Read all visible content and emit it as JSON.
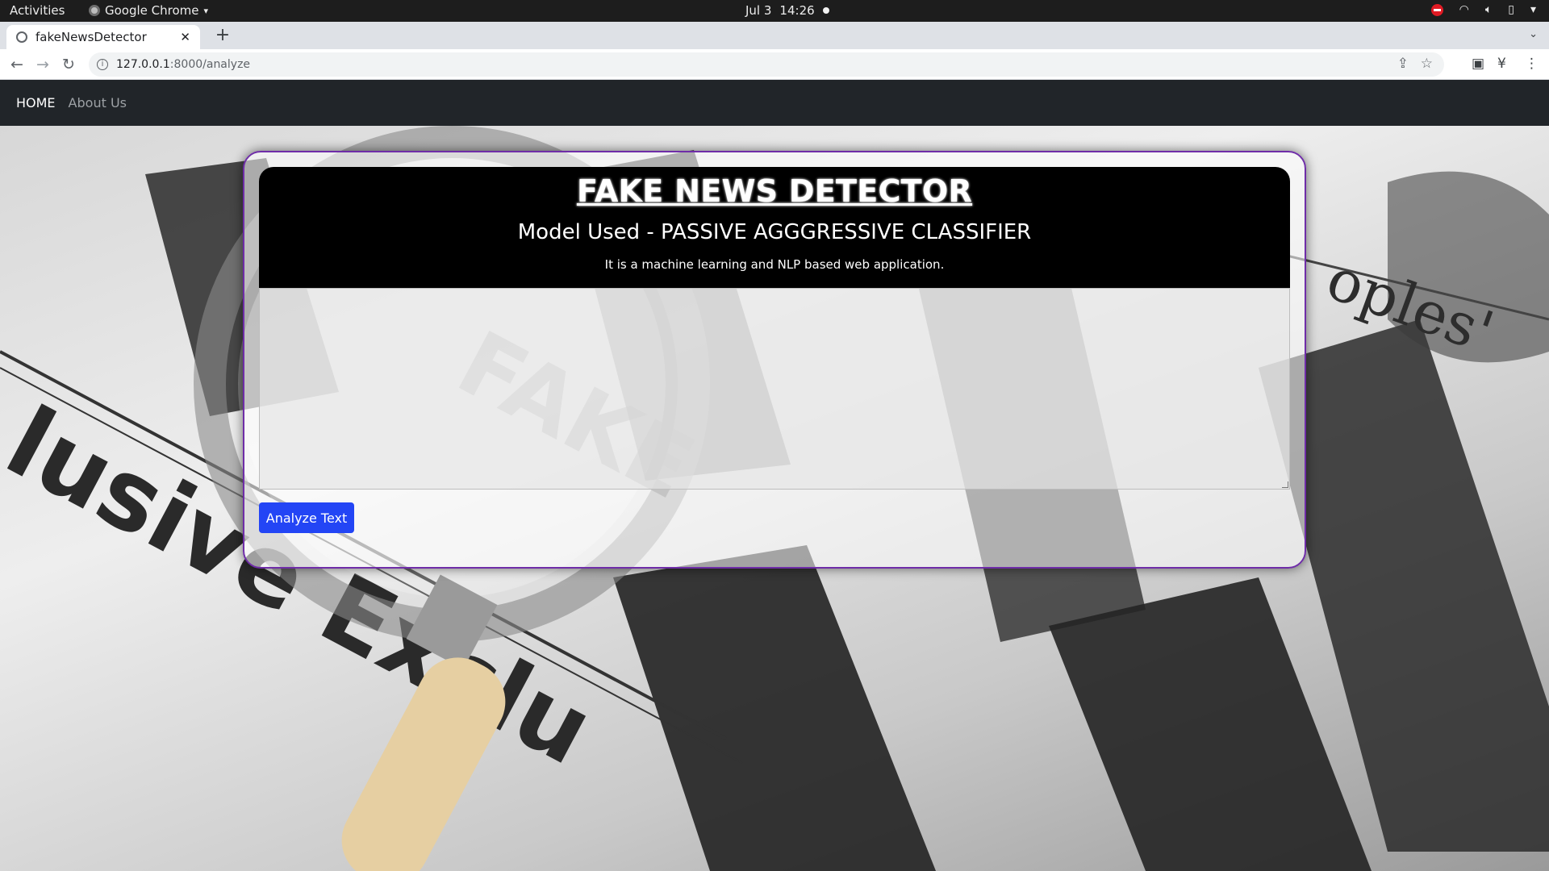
{
  "system_bar": {
    "activities": "Activities",
    "app_name": "Google Chrome",
    "date": "Jul 3",
    "time": "14:26"
  },
  "browser": {
    "tab_title": "fakeNewsDetector",
    "url_host": "127.0.0.1",
    "url_rest": ":8000/analyze"
  },
  "navbar": {
    "home": "HOME",
    "about": "About Us"
  },
  "card": {
    "title": "FAKE NEWS DETECTOR",
    "model": "Model Used - PASSIVE AGGGRESSIVE CLASSIFIER",
    "description": "It is a machine learning and NLP based web application.",
    "textarea_value": "",
    "button": "Analyze Text"
  },
  "colors": {
    "navbar_bg": "#212529",
    "card_border": "#6f2da8",
    "header_bg": "#000000",
    "button_bg": "#2345f5"
  },
  "icons": [
    "chrome-icon",
    "globe-icon",
    "close-icon",
    "plus-icon",
    "back-icon",
    "forward-icon",
    "reload-icon",
    "info-icon",
    "share-icon",
    "star-icon",
    "sidepanel-icon",
    "extension-icon",
    "menu-icon",
    "wifi-icon",
    "volume-icon",
    "battery-icon"
  ]
}
